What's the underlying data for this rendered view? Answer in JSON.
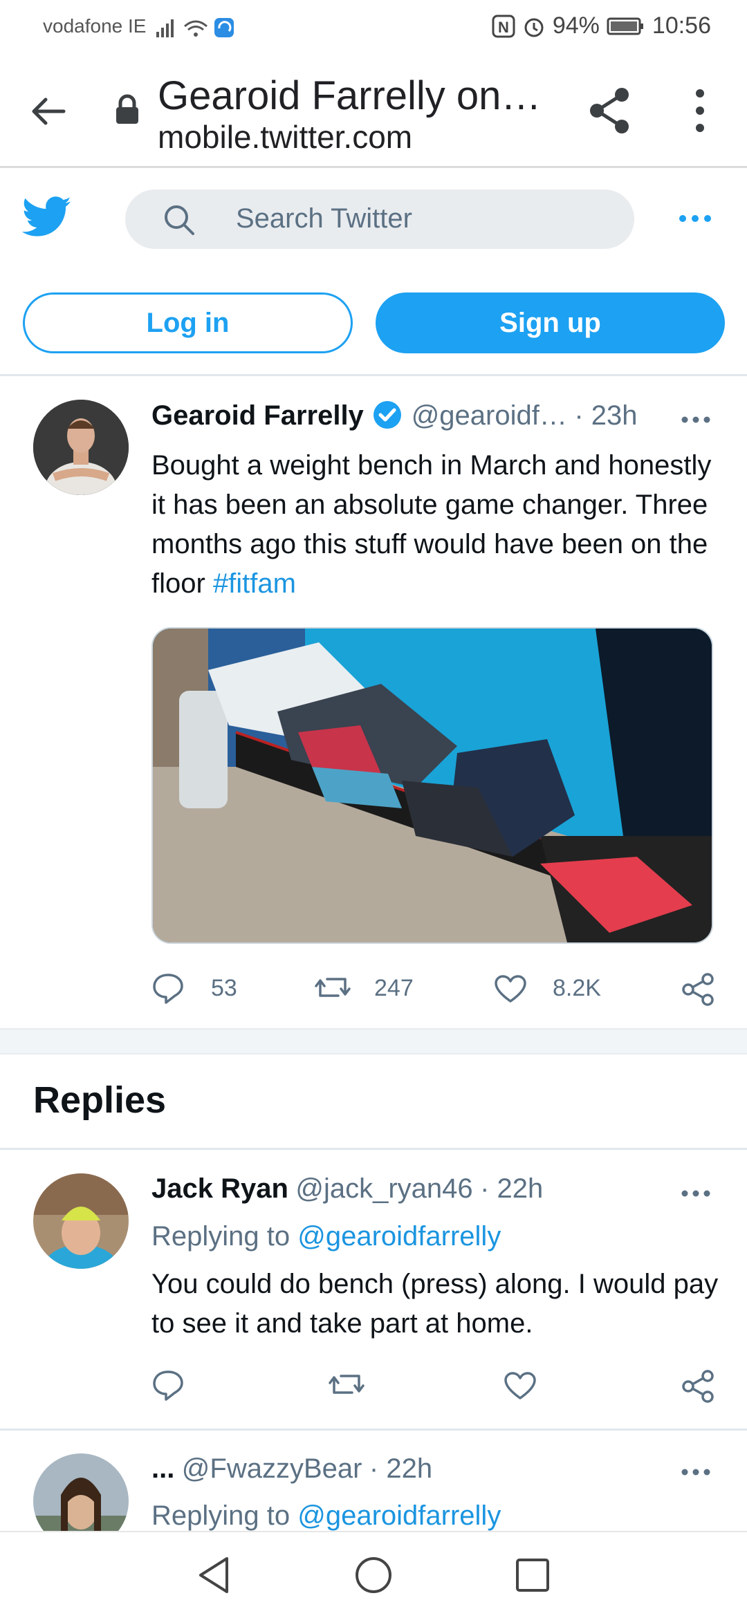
{
  "status_bar": {
    "carrier": "vodafone IE",
    "battery": "94%",
    "time": "10:56"
  },
  "browser": {
    "page_title": "Gearoid Farrelly on…",
    "url": "mobile.twitter.com"
  },
  "twitter_header": {
    "search_placeholder": "Search Twitter",
    "login_label": "Log in",
    "signup_label": "Sign up",
    "brand_color": "#1da1f2"
  },
  "main_tweet": {
    "author_name": "Gearoid Farrelly",
    "handle": "@gearoidf…",
    "time": "· 23h",
    "text": "Bought a weight bench in March and honestly it has been an absolute game changer. Three months ago this stuff would have been on the floor",
    "hashtag": "#fitfam",
    "replies": "53",
    "retweets": "247",
    "likes": "8.2K",
    "verified": true
  },
  "replies_section": {
    "heading": "Replies",
    "items": [
      {
        "author_name": "Jack Ryan",
        "handle": "@jack_ryan46",
        "time": "· 22h",
        "replying_to_prefix": "Replying to",
        "replying_to": "@gearoidfarrelly",
        "text": "You could do bench (press) along. I would pay to see it and take part at home."
      },
      {
        "author_name": "...",
        "handle": "@FwazzyBear",
        "time": "· 22h",
        "replying_to_prefix": "Replying to",
        "replying_to": "@gearoidfarrelly"
      }
    ]
  }
}
